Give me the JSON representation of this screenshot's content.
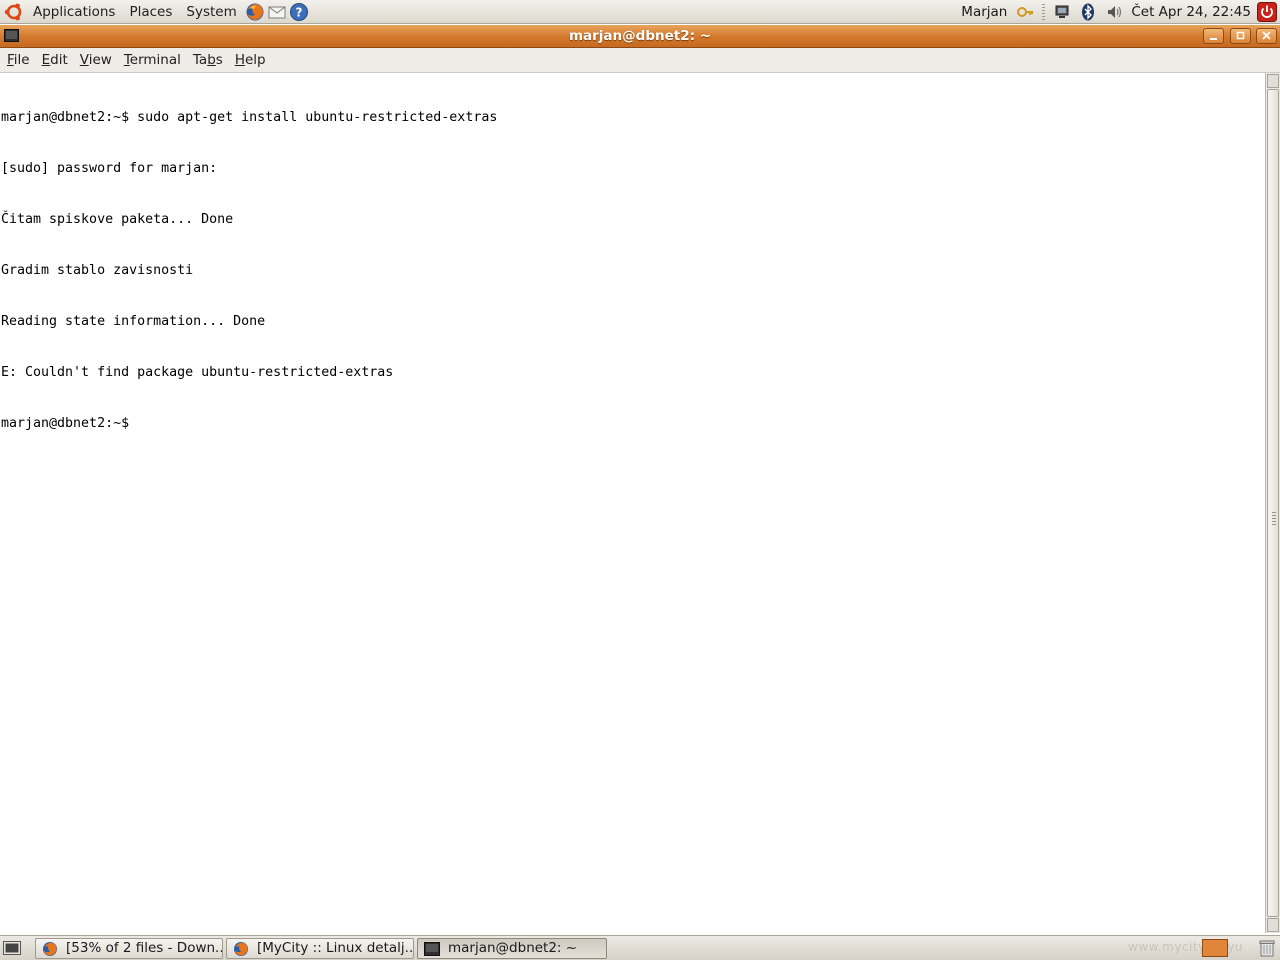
{
  "top_panel": {
    "menus": [
      "Applications",
      "Places",
      "System"
    ],
    "launchers": [
      "firefox-icon",
      "mail-icon",
      "help-icon"
    ],
    "user": "Marjan",
    "clock": "Čet Apr 24, 22:45"
  },
  "window": {
    "title": "marjan@dbnet2: ~",
    "menus": [
      {
        "pre": "",
        "u": "F",
        "post": "ile"
      },
      {
        "pre": "",
        "u": "E",
        "post": "dit"
      },
      {
        "pre": "",
        "u": "V",
        "post": "iew"
      },
      {
        "pre": "",
        "u": "T",
        "post": "erminal"
      },
      {
        "pre": "Ta",
        "u": "b",
        "post": "s"
      },
      {
        "pre": "",
        "u": "H",
        "post": "elp"
      }
    ]
  },
  "terminal": {
    "lines": [
      "marjan@dbnet2:~$ sudo apt-get install ubuntu-restricted-extras",
      "[sudo] password for marjan:",
      "Čitam spiskove paketa... Done",
      "Gradim stablo zavisnosti",
      "Reading state information... Done",
      "E: Couldn't find package ubuntu-restricted-extras",
      "marjan@dbnet2:~$ "
    ]
  },
  "taskbar": {
    "tasks": [
      {
        "label": "[53% of 2 files - Down...",
        "icon": "firefox-icon",
        "active": false
      },
      {
        "label": "[MyCity :: Linux detalj...",
        "icon": "firefox-icon",
        "active": false
      },
      {
        "label": "marjan@dbnet2: ~",
        "icon": "terminal-icon",
        "active": true
      }
    ],
    "watermark": "www.mycity.co.yu"
  },
  "colors": {
    "titlebar": "#d3772b",
    "panel": "#dcd8ce",
    "terminal_bg": "#ffffff"
  }
}
